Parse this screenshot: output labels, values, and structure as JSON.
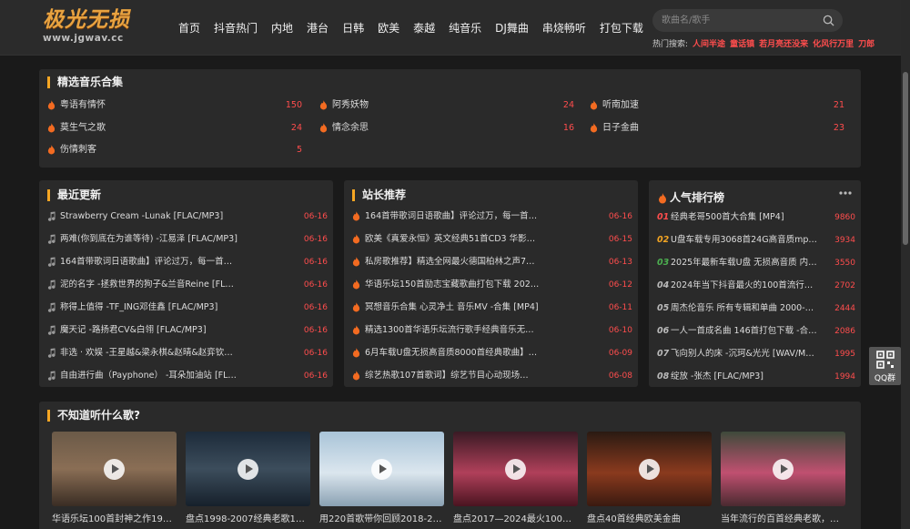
{
  "logo": {
    "main": "极光无损",
    "sub": "www.jgwav.cc"
  },
  "nav": [
    "首页",
    "抖音热门",
    "内地",
    "港台",
    "日韩",
    "欧美",
    "泰越",
    "纯音乐",
    "DJ舞曲",
    "串烧畅听",
    "打包下载"
  ],
  "search": {
    "placeholder": "歌曲名/歌手",
    "icon": "search-icon"
  },
  "hot": {
    "label": "热门搜索:",
    "keywords": [
      "人间半途",
      "童话镇",
      "若月亮还没来",
      "化风行万里",
      "刀郎"
    ]
  },
  "collections": {
    "title": "精选音乐合集",
    "items": [
      {
        "name": "粤语有情怀",
        "count": "150"
      },
      {
        "name": "阿秀妖物",
        "count": "24"
      },
      {
        "name": "听南加速",
        "count": "21"
      },
      {
        "name": "莫生气之歌",
        "count": "24"
      },
      {
        "name": "情念余思",
        "count": "16"
      },
      {
        "name": "日子金曲",
        "count": "23"
      },
      {
        "name": "伤情刺客",
        "count": "5"
      }
    ]
  },
  "latest": {
    "title": "最近更新",
    "rows": [
      {
        "t": "Strawberry Cream -Lunak [FLAC/MP3]",
        "d": "06-16"
      },
      {
        "t": "两难(你到底在为谁等待) -江易泽 [FLAC/MP3]",
        "d": "06-16"
      },
      {
        "t": "164首带歌词日语歌曲】评论过万，每一首…",
        "d": "06-16"
      },
      {
        "t": "泥的名字 -拯救世界的狗子&兰音Reine [FL…",
        "d": "06-16"
      },
      {
        "t": "称得上值得 -TF_ING邓佳鑫 [FLAC/MP3]",
        "d": "06-16"
      },
      {
        "t": "魔天记 -路扬君CV&白翎 [FLAC/MP3]",
        "d": "06-16"
      },
      {
        "t": "非选 · 欢娱 -王星越&梁永棋&赵晴&赵弈钦…",
        "d": "06-16"
      },
      {
        "t": "自由进行曲（Payphone） -耳朵加油站 [FL…",
        "d": "06-16"
      }
    ]
  },
  "recommend": {
    "title": "站长推荐",
    "rows": [
      {
        "t": "164首带歌词日语歌曲】评论过万，每一首…",
        "d": "06-16"
      },
      {
        "t": "欧美《真爱永恒》英文经典51首CD3 华影…",
        "d": "06-15"
      },
      {
        "t": "私房歌推荐】精选全网最火德国柏林之声7…",
        "d": "06-13"
      },
      {
        "t": "华语乐坛150首励志宝藏歌曲打包下载 202…",
        "d": "06-12"
      },
      {
        "t": "冥想音乐合集 心灵净土 音乐MV -合集 [MP4]",
        "d": "06-11"
      },
      {
        "t": "精选1300首华语乐坛流行歌手经典音乐无…",
        "d": "06-10"
      },
      {
        "t": "6月车载U盘无损高音质8000首经典歌曲】…",
        "d": "06-09"
      },
      {
        "t": "综艺热歌107首歌词】综艺节目心动现场…",
        "d": "06-08"
      }
    ]
  },
  "ranking": {
    "title": "人气排行榜",
    "rows": [
      {
        "r": "01",
        "t": "经典老哥500首大合集 [MP4]",
        "v": "9860"
      },
      {
        "r": "02",
        "t": "U盘车载专用3068首24G高音质mp…",
        "v": "3934"
      },
      {
        "r": "03",
        "t": "2025年最新车载U盘 无损高音质 内…",
        "v": "3550"
      },
      {
        "r": "04",
        "t": "2024年当下抖音最火的100首流行…",
        "v": "2702"
      },
      {
        "r": "05",
        "t": "周杰伦音乐 所有专辑和单曲 2000-2…",
        "v": "2444"
      },
      {
        "r": "06",
        "t": "一人一首成名曲 146首打包下载 -合…",
        "v": "2086"
      },
      {
        "r": "07",
        "t": "飞向别人的床 -沉珂&光光 [WAV/MP3]",
        "v": "1995"
      },
      {
        "r": "08",
        "t": "绽放 -张杰 [FLAC/MP3]",
        "v": "1994"
      }
    ]
  },
  "discover": {
    "title": "不知道听什么歌?",
    "videos": [
      {
        "cap": "华语乐坛100首封神之作1986…"
      },
      {
        "cap": "盘点1998-2007经典老歌100首"
      },
      {
        "cap": "用220首歌带你回顾2018-202…"
      },
      {
        "cap": "盘点2017—2024最火100首歌"
      },
      {
        "cap": "盘点40首经典欧美金曲"
      },
      {
        "cap": "当年流行的百首经典老歌，你…"
      }
    ]
  },
  "qq": {
    "label": "QQ群",
    "icon": "qr-code-icon"
  },
  "colors": {
    "accent": "#f5a623",
    "hot": "#ff4d4d"
  }
}
